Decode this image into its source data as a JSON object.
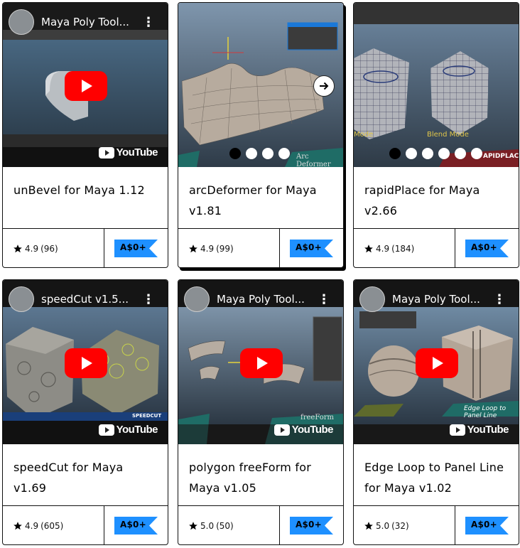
{
  "cards": [
    {
      "title": "unBevel for Maya 1.12",
      "rating": "4.9",
      "review_count": "(96)",
      "price": "A$0+",
      "media": "youtube",
      "video_title": "Maya Poly Tool...",
      "youtube_label": "YouTube"
    },
    {
      "title": "arcDeformer for Maya v1.81",
      "rating": "4.9",
      "review_count": "(99)",
      "price": "A$0+",
      "media": "carousel",
      "slides": 4,
      "active_slide": 1,
      "caption": "Arc Deformer"
    },
    {
      "title": "rapidPlace for Maya v2.66",
      "rating": "4.9",
      "review_count": "(184)",
      "price": "A$0+",
      "media": "carousel",
      "slides": 6,
      "active_slide": 1,
      "caption_left": "Mode",
      "caption_right": "Blend Mode",
      "caption_brand": "APIDPLACE"
    },
    {
      "title": "speedCut for Maya v1.69",
      "rating": "4.9",
      "review_count": "(605)",
      "price": "A$0+",
      "media": "youtube",
      "video_title": "speedCut v1.5...",
      "youtube_label": "YouTube",
      "caption": "SPEEDCUT"
    },
    {
      "title": "polygon freeForm for Maya v1.05",
      "rating": "5.0",
      "review_count": "(50)",
      "price": "A$0+",
      "media": "youtube",
      "video_title": "Maya Poly Tool...",
      "youtube_label": "YouTube",
      "caption": "freeForm"
    },
    {
      "title": "Edge Loop to Panel Line for Maya v1.02",
      "rating": "5.0",
      "review_count": "(32)",
      "price": "A$0+",
      "media": "youtube",
      "video_title": "Maya Poly Tool...",
      "youtube_label": "YouTube",
      "caption": "Edge Loop to Panel Line"
    }
  ],
  "colors": {
    "price_tag_bg": "#1e90ff",
    "youtube_red": "#ff0000",
    "card_border": "#111111"
  }
}
